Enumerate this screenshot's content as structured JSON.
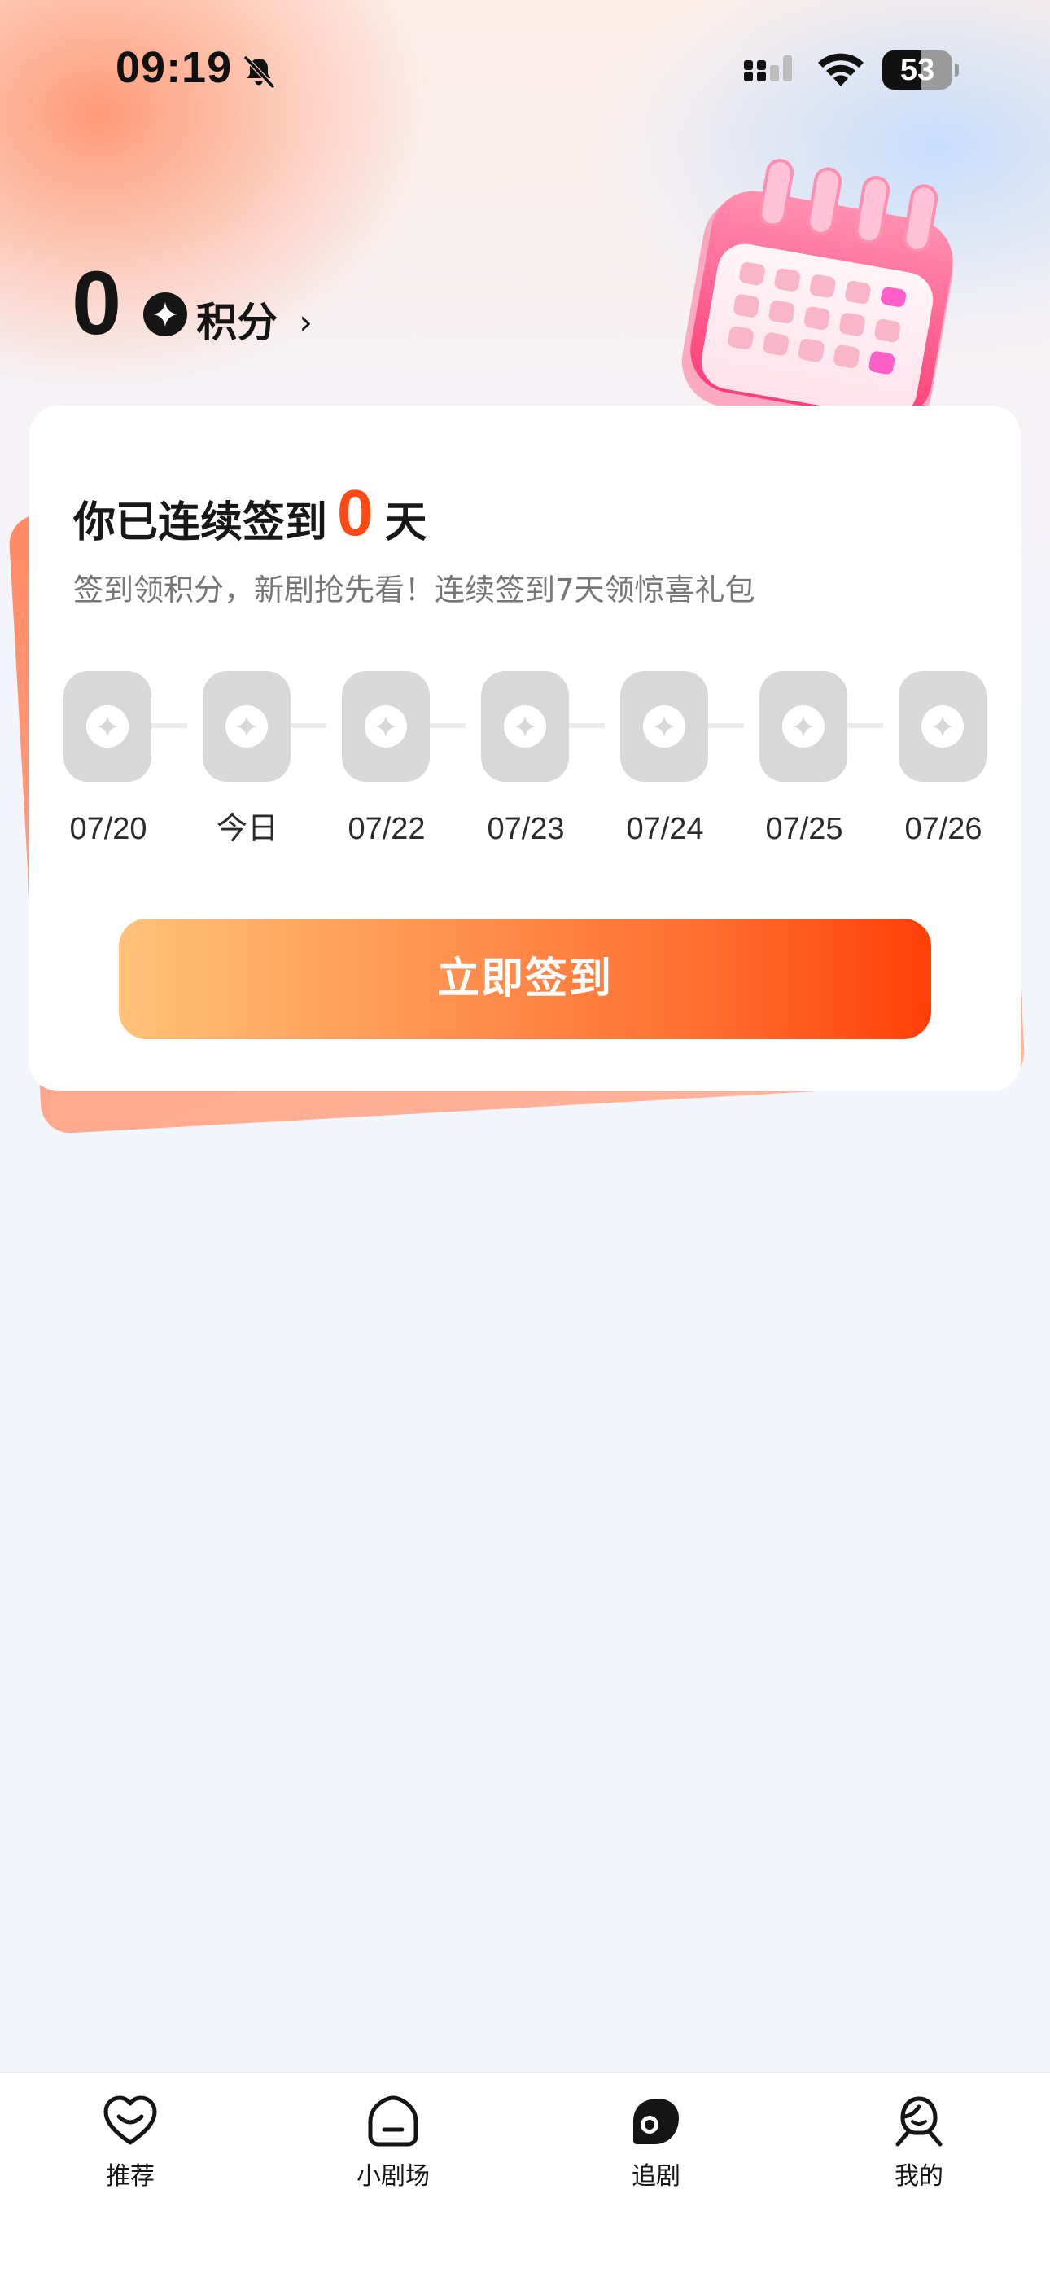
{
  "status_bar": {
    "time": "09:19",
    "battery": "53"
  },
  "points": {
    "value": "0",
    "label": "积分",
    "chevron": "›"
  },
  "checkin": {
    "title_prefix": "你已连续签到",
    "streak_days": "0",
    "title_suffix": "天",
    "description": "签到领积分，新剧抢先看！连续签到7天领惊喜礼包",
    "days": [
      {
        "label": "07/20",
        "checked": false
      },
      {
        "label": "今日",
        "checked": false
      },
      {
        "label": "07/22",
        "checked": false
      },
      {
        "label": "07/23",
        "checked": false
      },
      {
        "label": "07/24",
        "checked": false
      },
      {
        "label": "07/25",
        "checked": false
      },
      {
        "label": "07/26",
        "checked": false
      }
    ],
    "button_label": "立即签到"
  },
  "tab_bar": {
    "items": [
      {
        "label": "推荐",
        "icon": "heart-smile-icon"
      },
      {
        "label": "小剧场",
        "icon": "theater-icon"
      },
      {
        "label": "追剧",
        "icon": "follow-drama-icon"
      },
      {
        "label": "我的",
        "icon": "profile-icon"
      }
    ]
  },
  "colors": {
    "accent": "#ff4a16",
    "button_start": "#ffc27a",
    "button_end": "#ff3f08",
    "day_badge": "#d8d8d8",
    "page_background": "#f3f5fd"
  }
}
